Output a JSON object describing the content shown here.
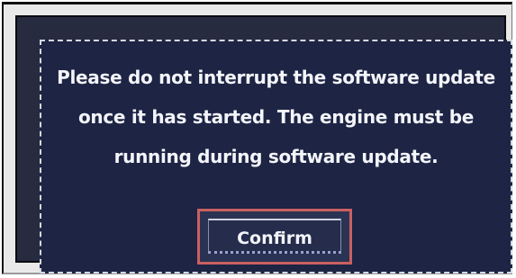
{
  "dialog": {
    "message_lines": [
      "Please do not interrupt the software update",
      "once it has started. The engine must be",
      "running during software update."
    ],
    "confirm_label": "Confirm"
  },
  "colors": {
    "dialog_background": "#1d2444",
    "text": "#f4f5fa",
    "button_focus_border": "#c96060"
  }
}
